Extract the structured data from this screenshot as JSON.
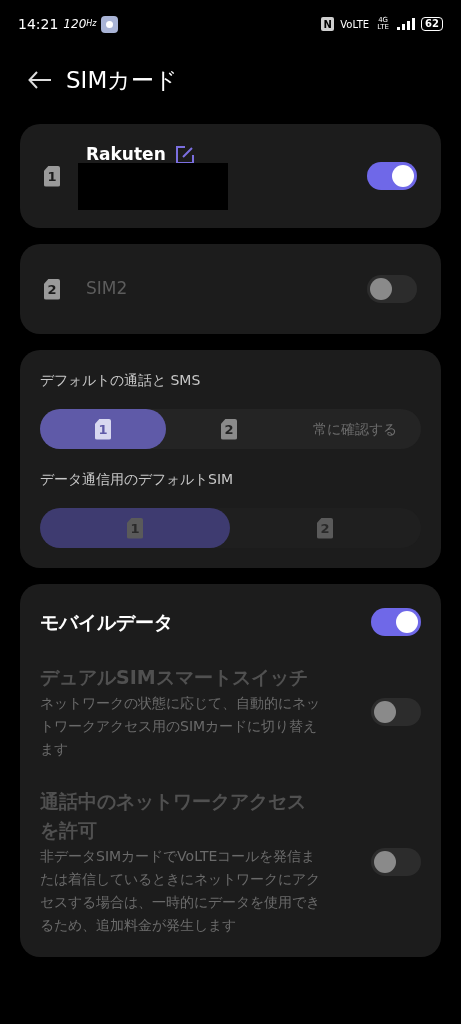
{
  "status_bar": {
    "time": "14:21",
    "refresh_rate": "120",
    "refresh_unit": "Hz",
    "nfc": "N",
    "network": "VoLTE",
    "signal_label": "4G LTE",
    "battery": "62"
  },
  "header": {
    "title": "SIMカード"
  },
  "sims": [
    {
      "slot": "1",
      "name": "Rakuten",
      "editable": true,
      "redacted": true,
      "on": true,
      "disabled": false
    },
    {
      "slot": "2",
      "name": "SIM2",
      "editable": false,
      "redacted": false,
      "on": false,
      "disabled": true
    }
  ],
  "defaults": [
    {
      "label": "デフォルトの通話と SMS",
      "disabled": false,
      "options": [
        {
          "kind": "sim",
          "slot": "1",
          "selected": true
        },
        {
          "kind": "sim",
          "slot": "2",
          "selected": false
        },
        {
          "kind": "text",
          "label": "常に確認する",
          "selected": false
        }
      ]
    },
    {
      "label": "データ通信用のデフォルトSIM",
      "disabled": true,
      "options": [
        {
          "kind": "sim",
          "slot": "1",
          "selected": true
        },
        {
          "kind": "sim",
          "slot": "2",
          "selected": false
        }
      ]
    }
  ],
  "mobile_data": {
    "title": "モバイルデータ",
    "on": true
  },
  "settings": [
    {
      "title": "デュアルSIMスマートスイッチ",
      "description": "ネットワークの状態に応じて、自動的にネットワークアクセス用のSIMカードに切り替えます",
      "on": false,
      "disabled": true
    },
    {
      "title": "通話中のネットワークアクセスを許可",
      "description": "非データSIMカードでVoLTEコールを発信または着信しているときにネットワークにアクセスする場合は、一時的にデータを使用できるため、追加料金が発生します",
      "on": false,
      "disabled": true
    }
  ]
}
